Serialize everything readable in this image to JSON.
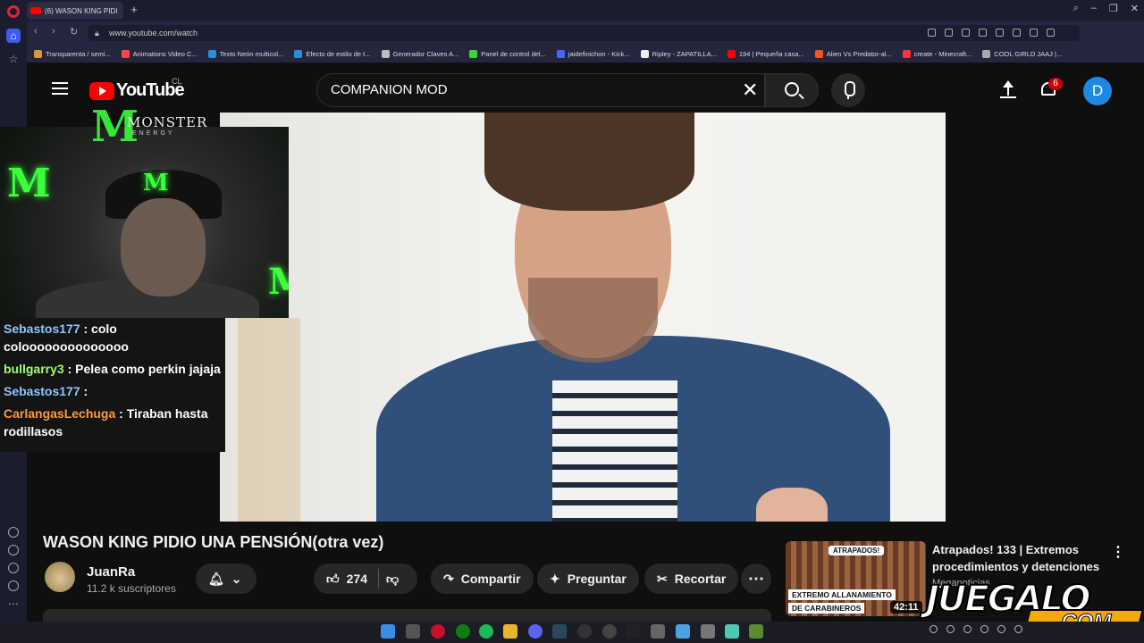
{
  "browser": {
    "tab_title": "(6) WASON KING PIDI",
    "url": "www.youtube.com/watch",
    "bookmarks": [
      {
        "label": "Transparenta / semi...",
        "color": "#d89a2c"
      },
      {
        "label": "Animations Video C...",
        "color": "#ff4444"
      },
      {
        "label": "Texto Neón multicol...",
        "color": "#2e8bd8"
      },
      {
        "label": "Efecto de estilo de t...",
        "color": "#2e8bd8"
      },
      {
        "label": "Generador Claves A...",
        "color": "#bbbbbb"
      },
      {
        "label": "Panel de control del...",
        "color": "#3bd43b"
      },
      {
        "label": "jaidefinichon - Kick...",
        "color": "#4466ff"
      },
      {
        "label": "Ripley - ZAPATILLA...",
        "color": "#eeeeee"
      },
      {
        "label": "194 | Pequeña casa...",
        "color": "#ff0000"
      },
      {
        "label": "Alien Vs Predator-al...",
        "color": "#ff5522"
      },
      {
        "label": "create - Minecraft...",
        "color": "#ff3333"
      },
      {
        "label": "COOL GIRLD JAAJ |...",
        "color": "#aaaaaa"
      }
    ]
  },
  "youtube": {
    "logo_text": "YouTube",
    "country": "CL",
    "search_value": "COMPANION MOD",
    "notification_count": "6",
    "avatar_letter": "D"
  },
  "overlay": {
    "brand": "MONSTER",
    "brand_sub": "ENERGY",
    "brand_m": "M"
  },
  "chat": [
    {
      "user": "Sebastos177",
      "user_color": "#8fc5ff",
      "text": ": colo coloooooooooooooo"
    },
    {
      "user": "bullgarry3",
      "user_color": "#9cff6c",
      "text": ": Pelea como perkin jajaja"
    },
    {
      "user": "Sebastos177",
      "user_color": "#8fc5ff",
      "text": ":"
    },
    {
      "user": "CarlangasLechuga",
      "user_color": "#ff9a3c",
      "text": ": Tiraban hasta rodillasos"
    }
  ],
  "video": {
    "title": "WASON KING PIDIO UNA PENSIÓN(otra vez)",
    "channel": "JuanRa",
    "subscribers": "11.2 k suscriptores",
    "likes": "274",
    "share_label": "Compartir",
    "ask_label": "Preguntar",
    "clip_label": "Recortar"
  },
  "recommended": {
    "title": "Atrapados! 133  | Extremos procedimientos y detenciones ...",
    "channel": "Meganoticias",
    "duration": "42:11",
    "thumb_tag": "ATRAPADOS!",
    "thumb_caption_1": "EXTREMO ALLANAMIENTO",
    "thumb_caption_2": "DE CARABINEROS"
  },
  "watermark": {
    "line1": "JUEGALO",
    "line2": ".COM"
  }
}
